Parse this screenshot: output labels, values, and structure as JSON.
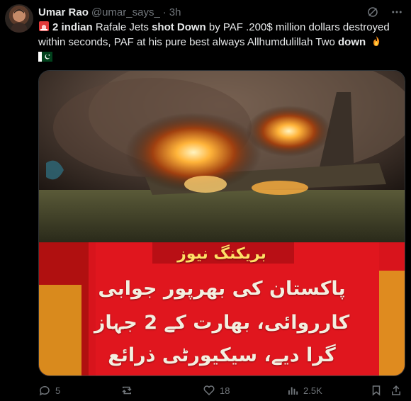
{
  "author": {
    "display_name": "Umar Rao",
    "handle": "@umar_says_",
    "separator": "·",
    "time": "3h"
  },
  "header_icons": [
    "grok-icon",
    "more-icon"
  ],
  "tweet": {
    "seg1": "2 indian",
    "seg2": " Rafale Jets ",
    "seg3": "shot Down",
    "seg4": " by PAF .200$ million dollars destroyed within seconds, PAF at his pure best always Allhumdulillah Two ",
    "seg5": "down",
    "emojis": [
      "siren-emoji",
      "fire-emoji",
      "pakistan-flag-emoji"
    ]
  },
  "media": {
    "photo_description_icon": "burning-jet-wreckage-image",
    "breaking_title": "بریکنگ نیوز",
    "breaking_line1": "پاکستان کی بھرپور جوابی",
    "breaking_line2": "کارروائی، بھارت کے 2 جہاز",
    "breaking_line3": "گرا دیے، سیکیورٹی ذرائع",
    "banner_color": "#d8141c"
  },
  "actions": {
    "replies": "5",
    "retweets": "",
    "likes": "18",
    "views": "2.5K"
  },
  "colors": {
    "background": "#000000",
    "text": "#e7e9ea",
    "muted": "#71767b"
  }
}
